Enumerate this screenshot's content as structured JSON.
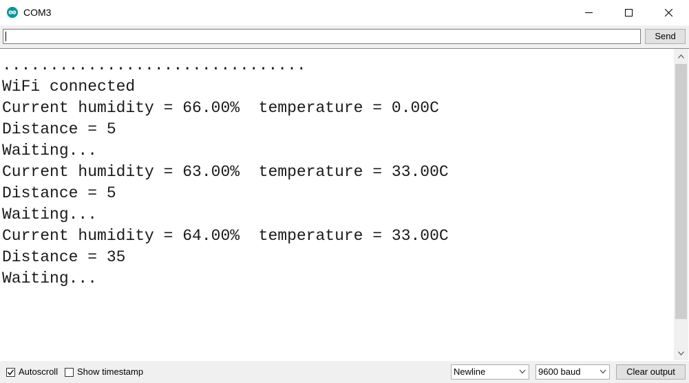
{
  "window": {
    "title": "COM3",
    "app_icon": "arduino-icon",
    "controls": [
      "minimize-icon",
      "maximize-icon",
      "close-icon"
    ]
  },
  "input": {
    "value": "",
    "send_label": "Send"
  },
  "output": {
    "lines": [
      "................................",
      "WiFi connected",
      "Current humidity = 66.00%  temperature = 0.00C",
      "Distance = 5",
      "Waiting...",
      "Current humidity = 63.00%  temperature = 33.00C",
      "Distance = 5",
      "Waiting...",
      "Current humidity = 64.00%  temperature = 33.00C",
      "Distance = 35",
      "Waiting..."
    ]
  },
  "footer": {
    "autoscroll": {
      "label": "Autoscroll",
      "checked": true
    },
    "timestamp": {
      "label": "Show timestamp",
      "checked": false
    },
    "line_ending": "Newline",
    "baud": "9600 baud",
    "clear_label": "Clear output"
  },
  "colors": {
    "accent": "#00979c"
  }
}
